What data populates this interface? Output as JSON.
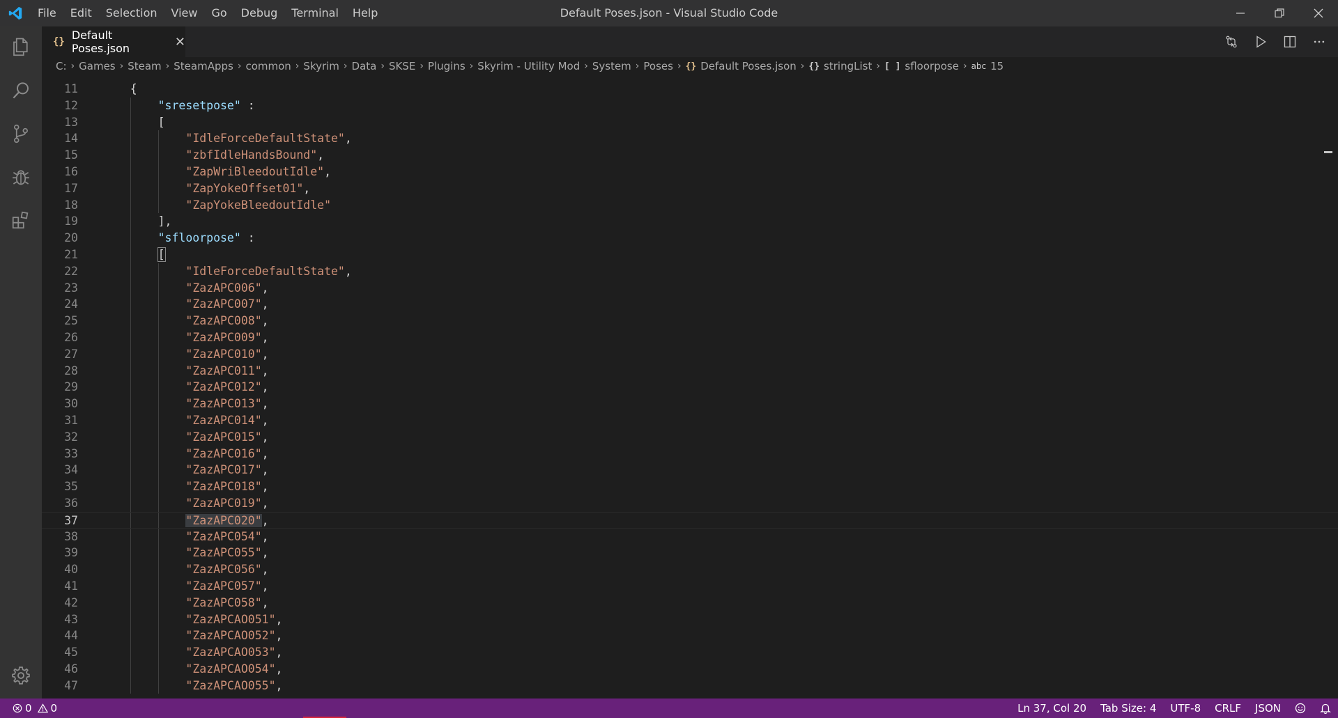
{
  "window": {
    "title": "Default Poses.json - Visual Studio Code"
  },
  "menu": {
    "items": [
      "File",
      "Edit",
      "Selection",
      "View",
      "Go",
      "Debug",
      "Terminal",
      "Help"
    ]
  },
  "tab": {
    "icon_glyph": "{}",
    "label": "Default Poses.json",
    "close": "✕"
  },
  "breadcrumb": {
    "path": [
      "C:",
      "Games",
      "Steam",
      "SteamApps",
      "common",
      "Skyrim",
      "Data",
      "SKSE",
      "Plugins",
      "Skyrim - Utility Mod",
      "System",
      "Poses"
    ],
    "file_glyph": "{}",
    "file": "Default Poses.json",
    "obj_glyph": "{}",
    "obj": "stringList",
    "arr_glyph": "[ ]",
    "arr": "sfloorpose",
    "leaf_glyph": "abc",
    "leaf": "15"
  },
  "editor": {
    "lines": [
      {
        "n": "11",
        "text": "{"
      },
      {
        "n": "12",
        "key": "\"sresetpose\"",
        "suffix": " :"
      },
      {
        "n": "13",
        "text": "["
      },
      {
        "n": "14",
        "str": "\"IdleForceDefaultState\"",
        "suffix": ","
      },
      {
        "n": "15",
        "str": "\"zbfIdleHandsBound\"",
        "suffix": ","
      },
      {
        "n": "16",
        "str": "\"ZapWriBleedoutIdle\"",
        "suffix": ","
      },
      {
        "n": "17",
        "str": "\"ZapYokeOffset01\"",
        "suffix": ","
      },
      {
        "n": "18",
        "str": "\"ZapYokeBleedoutIdle\"",
        "suffix": ""
      },
      {
        "n": "19",
        "text": "],"
      },
      {
        "n": "20",
        "key": "\"sfloorpose\"",
        "suffix": " :"
      },
      {
        "n": "21",
        "text": "["
      },
      {
        "n": "22",
        "str": "\"IdleForceDefaultState\"",
        "suffix": ","
      },
      {
        "n": "23",
        "str": "\"ZazAPC006\"",
        "suffix": ","
      },
      {
        "n": "24",
        "str": "\"ZazAPC007\"",
        "suffix": ","
      },
      {
        "n": "25",
        "str": "\"ZazAPC008\"",
        "suffix": ","
      },
      {
        "n": "26",
        "str": "\"ZazAPC009\"",
        "suffix": ","
      },
      {
        "n": "27",
        "str": "\"ZazAPC010\"",
        "suffix": ","
      },
      {
        "n": "28",
        "str": "\"ZazAPC011\"",
        "suffix": ","
      },
      {
        "n": "29",
        "str": "\"ZazAPC012\"",
        "suffix": ","
      },
      {
        "n": "30",
        "str": "\"ZazAPC013\"",
        "suffix": ","
      },
      {
        "n": "31",
        "str": "\"ZazAPC014\"",
        "suffix": ","
      },
      {
        "n": "32",
        "str": "\"ZazAPC015\"",
        "suffix": ","
      },
      {
        "n": "33",
        "str": "\"ZazAPC016\"",
        "suffix": ","
      },
      {
        "n": "34",
        "str": "\"ZazAPC017\"",
        "suffix": ","
      },
      {
        "n": "35",
        "str": "\"ZazAPC018\"",
        "suffix": ","
      },
      {
        "n": "36",
        "str": "\"ZazAPC019\"",
        "suffix": ","
      },
      {
        "n": "37",
        "str": "\"ZazAPC020\"",
        "suffix": ",",
        "current": true
      },
      {
        "n": "38",
        "str": "\"ZazAPC054\"",
        "suffix": ","
      },
      {
        "n": "39",
        "str": "\"ZazAPC055\"",
        "suffix": ","
      },
      {
        "n": "40",
        "str": "\"ZazAPC056\"",
        "suffix": ","
      },
      {
        "n": "41",
        "str": "\"ZazAPC057\"",
        "suffix": ","
      },
      {
        "n": "42",
        "str": "\"ZazAPC058\"",
        "suffix": ","
      },
      {
        "n": "43",
        "str": "\"ZazAPCAO051\"",
        "suffix": ","
      },
      {
        "n": "44",
        "str": "\"ZazAPCAO052\"",
        "suffix": ","
      },
      {
        "n": "45",
        "str": "\"ZazAPCAO053\"",
        "suffix": ","
      },
      {
        "n": "46",
        "str": "\"ZazAPCAO054\"",
        "suffix": ","
      },
      {
        "n": "47",
        "str": "\"ZazAPCAO055\"",
        "suffix": ","
      }
    ]
  },
  "statusbar": {
    "errors": "0",
    "warnings": "0",
    "position": "Ln 37, Col 20",
    "tab_size": "Tab Size: 4",
    "encoding": "UTF-8",
    "eol": "CRLF",
    "language": "JSON"
  },
  "colors": {
    "statusbar": "#68217a",
    "activitybar": "#333333",
    "titlebar": "#323233",
    "editor_bg": "#1e1e1e",
    "json_key": "#9cdcfe",
    "json_string": "#ce9178",
    "vscode_blue": "#23a9f2"
  }
}
